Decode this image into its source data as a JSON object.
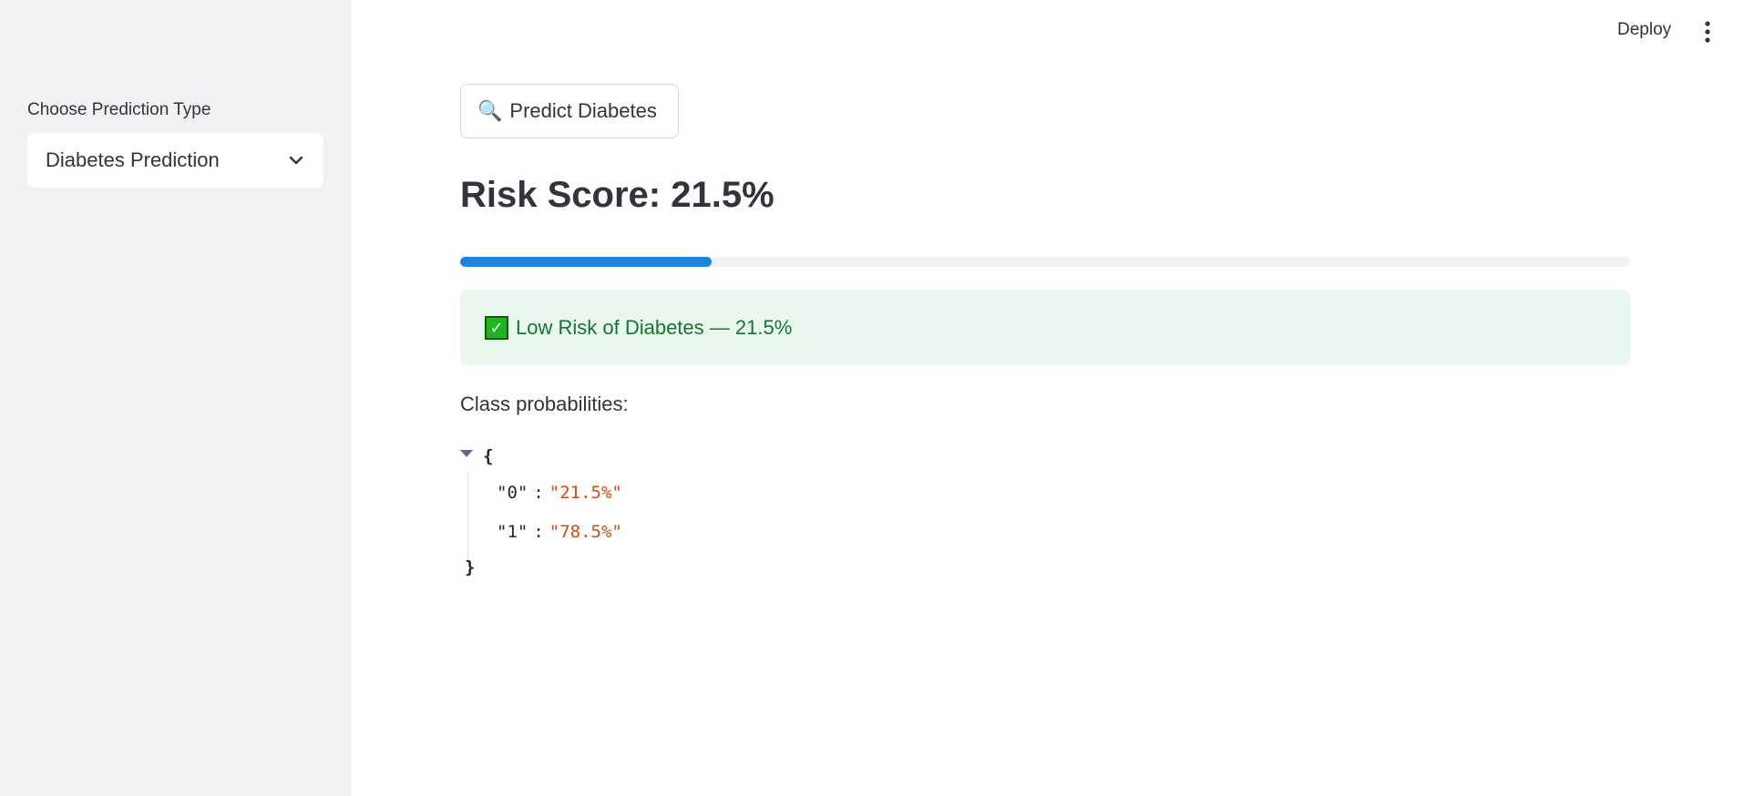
{
  "sidebar": {
    "select_label": "Choose Prediction Type",
    "select_value": "Diabetes Prediction",
    "chevron_icon": "chevron-down-icon"
  },
  "header": {
    "deploy_label": "Deploy",
    "menu_icon": "vertical-ellipsis-icon"
  },
  "main": {
    "predict_button": {
      "icon": "🔍",
      "label": "Predict Diabetes"
    },
    "risk_title": "Risk Score: 21.5%",
    "progress_percent": 21.5,
    "alert": {
      "icon": "✓",
      "text": "Low Risk of Diabetes — 21.5%",
      "background": "#e8f8ec",
      "text_color": "#177233"
    },
    "class_prob_label": "Class probabilities:",
    "json": {
      "open_brace": "{",
      "close_brace": "}",
      "rows": [
        {
          "key": "\"0\"",
          "colon": ":",
          "value": "\"21.5%\""
        },
        {
          "key": "\"1\"",
          "colon": ":",
          "value": "\"78.5%\""
        }
      ]
    }
  },
  "colors": {
    "accent": "#1c83e1",
    "sidebar_bg": "#f0f2f6",
    "json_value": "#d9480f"
  }
}
